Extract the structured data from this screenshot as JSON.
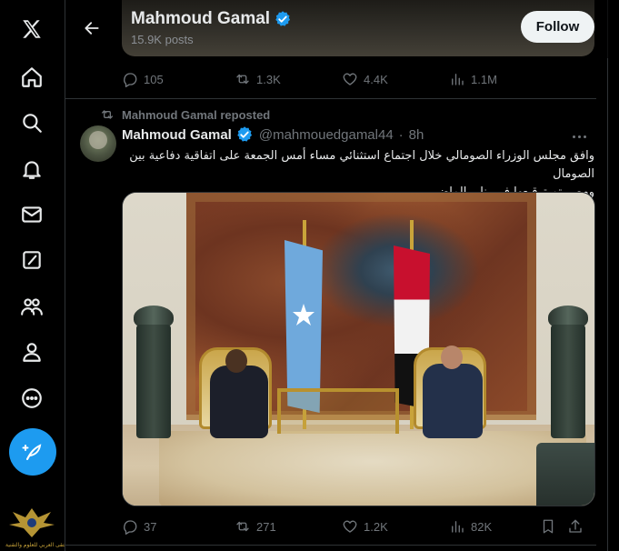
{
  "nav": {
    "items": [
      {
        "name": "x-logo",
        "icon": "x-logo-icon"
      },
      {
        "name": "home",
        "icon": "home-icon"
      },
      {
        "name": "explore",
        "icon": "search-icon"
      },
      {
        "name": "notifications",
        "icon": "bell-icon"
      },
      {
        "name": "messages",
        "icon": "mail-icon"
      },
      {
        "name": "grok",
        "icon": "grok-icon"
      },
      {
        "name": "communities",
        "icon": "people-icon"
      },
      {
        "name": "profile",
        "icon": "person-icon"
      },
      {
        "name": "more",
        "icon": "more-circle-icon"
      }
    ],
    "compose_icon": "feather-plus-icon",
    "watermark_text": "الملتقى العربي للعلوم والتقنية"
  },
  "header": {
    "name": "Mahmoud Gamal",
    "post_count": "15.9K posts",
    "follow_label": "Follow"
  },
  "prev_tweet_actions": {
    "replies": "105",
    "reposts": "1.3K",
    "likes": "4.4K",
    "views": "1.1M"
  },
  "tweet": {
    "repost_label": "Mahmoud Gamal reposted",
    "name": "Mahmoud Gamal",
    "handle": "@mahmouedgamal44",
    "separator": "·",
    "time": "8h",
    "text_line1": "وافق مجلس الوزراء الصومالي خلال اجتماع استثنائي مساء أمس الجمعة على اتفاقية دفاعية بين الصومال",
    "text_line2": "ومصر تم توقيعها في يناير الماضي.",
    "media_alt": "photo",
    "actions": {
      "replies": "37",
      "reposts": "271",
      "likes": "1.2K",
      "views": "82K"
    }
  },
  "colors": {
    "accent": "#1d9bf0",
    "background": "#000000",
    "muted": "#71767b",
    "text": "#e7e9ea",
    "border": "#2f3336"
  }
}
